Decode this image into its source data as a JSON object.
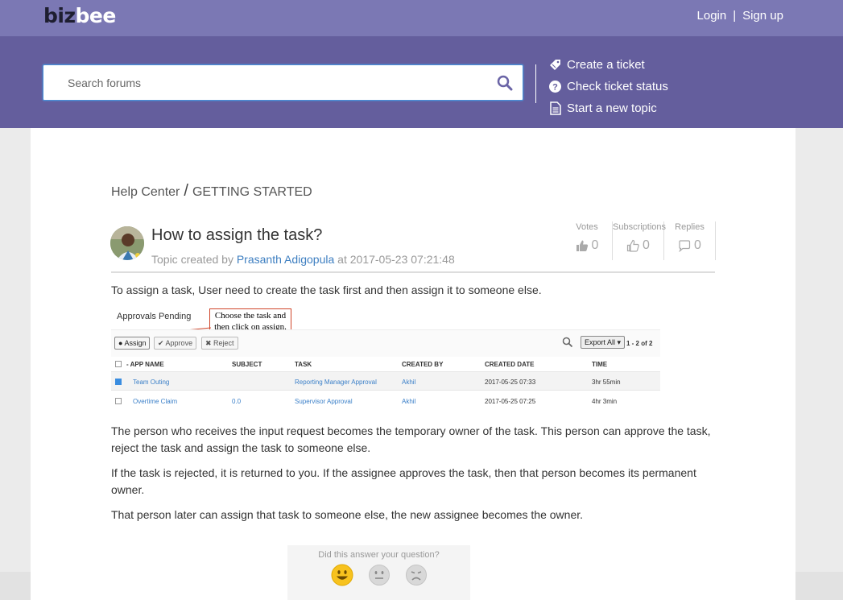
{
  "header": {
    "logo_biz": "biz",
    "logo_bee": "bee",
    "login": "Login",
    "separator": "|",
    "signup": "Sign up"
  },
  "search": {
    "placeholder": "Search forums"
  },
  "actions": [
    {
      "label": "Create a ticket",
      "icon": "ticket-icon"
    },
    {
      "label": "Check ticket status",
      "icon": "question-circle-icon"
    },
    {
      "label": "Start a new topic",
      "icon": "document-icon"
    }
  ],
  "breadcrumb": {
    "home": "Help Center",
    "sep": "/",
    "section": "GETTING STARTED"
  },
  "topic": {
    "title": "How to assign the task?",
    "meta_prefix": "Topic created by",
    "author": "Prasanth Adigopula",
    "meta_at": "at",
    "datetime": "2017-05-23 07:21:48"
  },
  "stats": {
    "votes_label": "Votes",
    "votes": "0",
    "subs_label": "Subscriptions",
    "subs": "0",
    "replies_label": "Replies",
    "replies": "0"
  },
  "body": {
    "p1": "To assign a task, User need to create the task first and then assign it to someone else.",
    "p2": "The person who receives the input request becomes the temporary owner of the task. This person can approve the task, reject the task and assign the task to someone else.",
    "p3": "If the task is rejected, it is returned to you. If the assignee approves the task, then that person becomes its permanent owner.",
    "p4": "That person later can assign that task to someone else, the new assignee becomes the owner."
  },
  "screenshot": {
    "title": "Approvals Pending",
    "callout_line1": "Choose the task and",
    "callout_line2": "then click on assign.",
    "btn_assign": "Assign",
    "btn_approve": "Approve",
    "btn_reject": "Reject",
    "export": "Export All",
    "paging": "1 - 2 of 2",
    "headers": {
      "app": "APP NAME",
      "subject": "SUBJECT",
      "task": "TASK",
      "created_by": "CREATED BY",
      "created_date": "CREATED DATE",
      "time": "TIME"
    },
    "rows": [
      {
        "app": "Team Outing",
        "subject": "",
        "task": "Reporting Manager Approval",
        "created_by": "Akhil",
        "created_date": "2017-05-25 07:33",
        "time": "3hr 55min"
      },
      {
        "app": "Overtime Claim",
        "subject": "0.0",
        "task": "Supervisor Approval",
        "created_by": "Akhil",
        "created_date": "2017-05-25 07:25",
        "time": "4hr 3min"
      }
    ]
  },
  "feedback": {
    "question": "Did this answer your question?"
  },
  "colors": {
    "topbar": "#7b78b4",
    "band": "#645e9d",
    "link": "#3e7fc1"
  }
}
